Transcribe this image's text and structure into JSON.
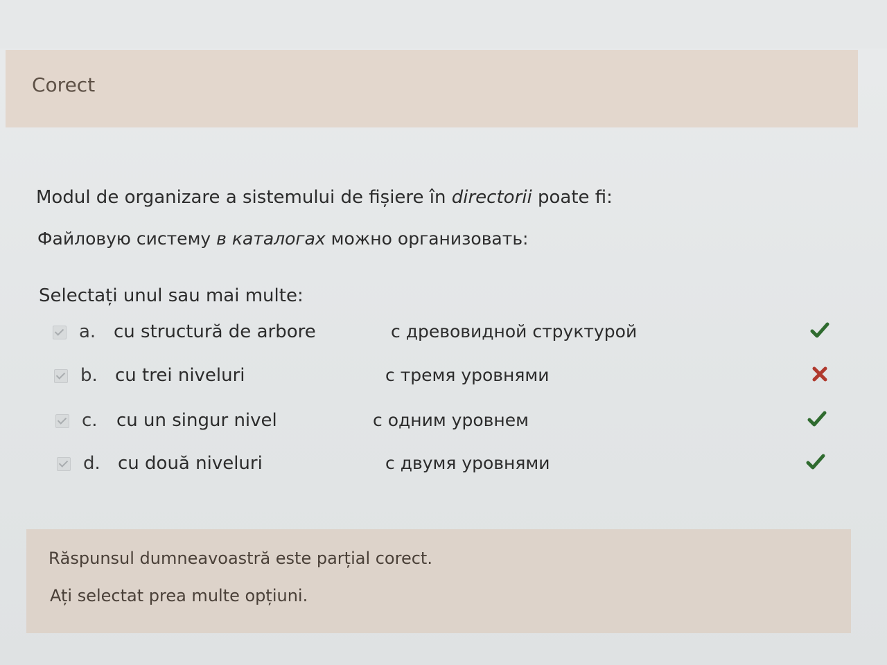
{
  "status": {
    "label": "Corect"
  },
  "question": {
    "ro_before": "Modul de organizare a sistemului de fișiere în ",
    "ro_italic": "directorii",
    "ro_after": " poate fi:",
    "ru_before": "Файловую систему ",
    "ru_italic": "в каталогах",
    "ru_after": " можно организовать:"
  },
  "prompt": "Selectați unul sau mai multe:",
  "options": [
    {
      "letter": "a.",
      "ro": "cu structură de arbore",
      "ru": "с древовидной структурой",
      "checked": true,
      "mark": "check-icon"
    },
    {
      "letter": "b.",
      "ro": "cu trei niveluri",
      "ru": "с тремя уровнями",
      "checked": true,
      "mark": "cross-icon"
    },
    {
      "letter": "c.",
      "ro": "cu un singur nivel",
      "ru": "с одним уровнем",
      "checked": true,
      "mark": "check-icon"
    },
    {
      "letter": "d.",
      "ro": "cu două niveluri",
      "ru": "с двумя уровнями",
      "checked": true,
      "mark": "check-icon"
    }
  ],
  "feedback": {
    "line1": "Răspunsul dumneavoastră este parțial corect.",
    "line2": "Ați selectat prea multe opțiuni."
  },
  "colors": {
    "correct": "#2f6b2f",
    "incorrect": "#b03a2e",
    "status_bg": "#e3d7cd",
    "feedback_bg": "#ddd3ca"
  }
}
